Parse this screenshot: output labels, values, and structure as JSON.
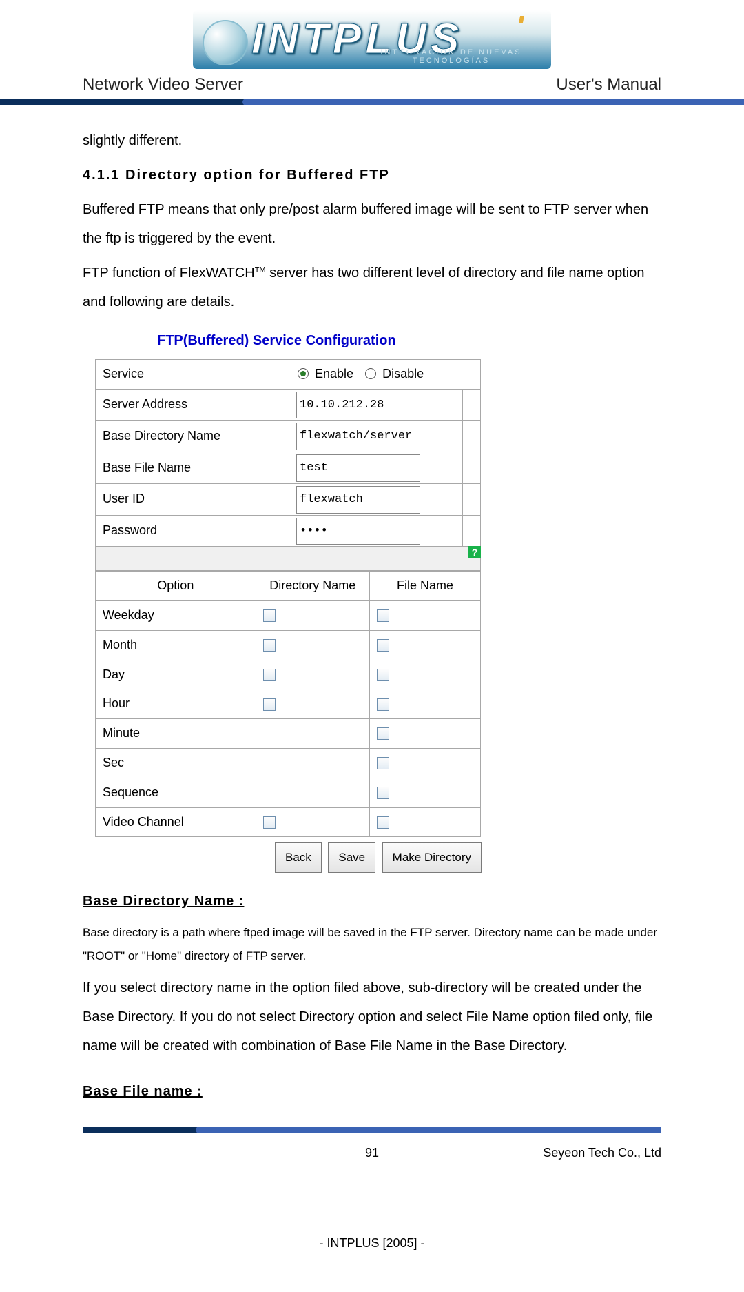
{
  "logo": {
    "brand": "INTPLUS",
    "tagline": "INTEGRACIÓN  DE  NUEVAS  TECNOLOGÍAS"
  },
  "header": {
    "left": "Network Video Server",
    "right": "User's Manual"
  },
  "body": {
    "p0": "slightly different.",
    "sec_num": "4.1.1",
    "sec_title": " Directory option for Buffered FTP",
    "p1": "Buffered FTP means that only pre/post alarm buffered image will be sent to FTP server when the ftp is triggered by the event.",
    "p2a": "FTP function of FlexWATCH",
    "p2_sup": "TM",
    "p2b": " server has two different level of directory and file name option and following are details.",
    "base_dir_h": "Base Directory Name :",
    "base_dir_note": "Base directory is a path where ftped image will be saved in the FTP server. Directory name can be made under \"ROOT\" or \"Home\" directory of FTP server.",
    "base_dir_p": "If you select directory name in the option filed above, sub-directory will be created under the Base Directory. If you do not select Directory option and select File Name option filed only, file name will be created with combination of Base File Name in the Base Directory.",
    "base_file_h": "Base File name :"
  },
  "config": {
    "title": "FTP(Buffered) Service Configuration",
    "rows": {
      "service_label": "Service",
      "enable_label": "Enable",
      "disable_label": "Disable",
      "server_addr_label": "Server Address",
      "server_addr_value": "10.10.212.28",
      "base_dir_label": "Base Directory Name",
      "base_dir_value": "flexwatch/server",
      "base_file_label": "Base File Name",
      "base_file_value": "test",
      "user_id_label": "User ID",
      "user_id_value": "flexwatch",
      "password_label": "Password",
      "password_value": "••••"
    },
    "help_badge": "?",
    "opt_headers": {
      "option": "Option",
      "dir": "Directory Name",
      "file": "File Name"
    },
    "opt_rows": [
      {
        "label": "Weekday",
        "dir": true,
        "file": true
      },
      {
        "label": "Month",
        "dir": true,
        "file": true
      },
      {
        "label": "Day",
        "dir": true,
        "file": true
      },
      {
        "label": "Hour",
        "dir": true,
        "file": true
      },
      {
        "label": "Minute",
        "dir": false,
        "file": true
      },
      {
        "label": "Sec",
        "dir": false,
        "file": true
      },
      {
        "label": "Sequence",
        "dir": false,
        "file": true
      },
      {
        "label": "Video Channel",
        "dir": true,
        "file": true
      }
    ],
    "buttons": {
      "back": "Back",
      "save": "Save",
      "makedir": "Make Directory"
    }
  },
  "footer": {
    "page": "91",
    "company": "Seyeon Tech Co., Ltd",
    "intplus": "- INTPLUS [2005] -"
  }
}
